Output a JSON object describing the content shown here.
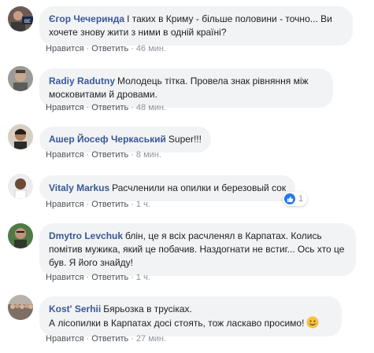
{
  "comments": [
    {
      "author": "Єгор Чечеринда",
      "text": "І таких в Криму - більше половини - точно... Ви хочете знову жити з ними в одній країні?",
      "like": "Нравится",
      "reply": "Ответить",
      "time": "46 мин."
    },
    {
      "author": "Radiy Radutny",
      "text": "Молодець тітка. Провела знак рівняння між московитами й дровами.",
      "like": "Нравится",
      "reply": "Ответить",
      "time": "48 мин."
    },
    {
      "author": "Ашер Йосеф Черкаський",
      "text": "Super!!!",
      "like": "Нравится",
      "reply": "Ответить",
      "time": "8 мин."
    },
    {
      "author": "Vitaly Markus",
      "text": "Расчленили на опилки и березовый сок",
      "like": "Нравится",
      "reply": "Ответить",
      "time": "1 ч.",
      "reactions": "1"
    },
    {
      "author": "Dmytro Levchuk",
      "text": "блін, це я всіх расчленял в Карпатах. Колись помітив мужика, який це побачив. Наздогнати не встиг... Ось хто це був. Я його знайду!",
      "like": "Нравится",
      "reply": "Ответить",
      "time": "1 ч."
    },
    {
      "author": "Kost' Serhii",
      "text": "Бярьозка в трусіках.",
      "text2": "А лісопилки в Карпатах досі стоять, тож ласкаво просимо!",
      "like": "Нравится",
      "reply": "Ответить",
      "time": "27 мин."
    }
  ],
  "avatar_badge": "BE",
  "sep": "·",
  "colors": {
    "author": "#385898",
    "bubble": "#f2f3f5",
    "meta": "#90949c",
    "like_badge": "#2078f4"
  }
}
